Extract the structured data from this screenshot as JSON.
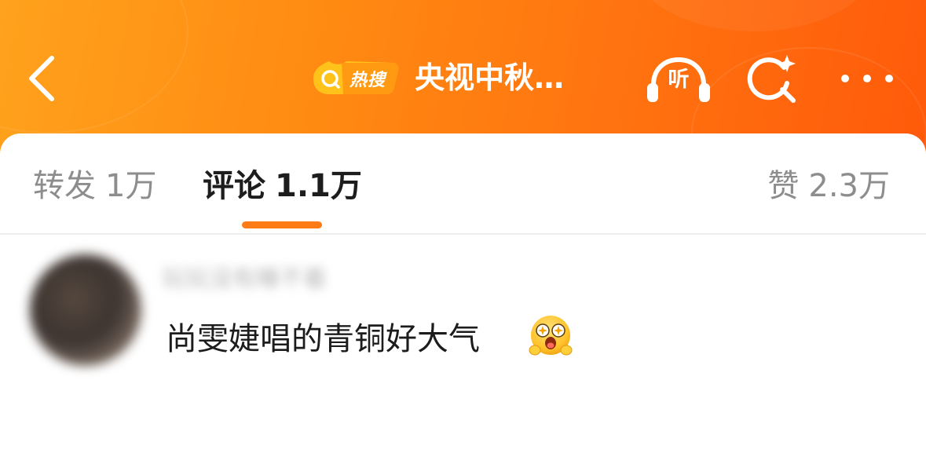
{
  "header": {
    "hot_badge_label": "热搜",
    "title": "央视中秋…",
    "listen_label": "听"
  },
  "tabs": [
    {
      "label": "转发",
      "count": "1万"
    },
    {
      "label": "评论",
      "count": "1.1万"
    },
    {
      "label": "赞",
      "count": "2.3万"
    }
  ],
  "comment": {
    "username": "玩玩没有睡不着",
    "text": "尚雯婕唱的青铜好大气"
  },
  "colors": {
    "header_start": "#ffa21c",
    "header_end": "#ff5a0a",
    "accent": "#ff7b16"
  },
  "icons": {
    "back": "back-arrow-icon",
    "hot_search": "hot-search-badge-icon",
    "listen": "headphones-icon",
    "search": "search-sparkle-icon",
    "more": "more-dots-icon",
    "emoji": "excited-face-emoji-icon"
  }
}
